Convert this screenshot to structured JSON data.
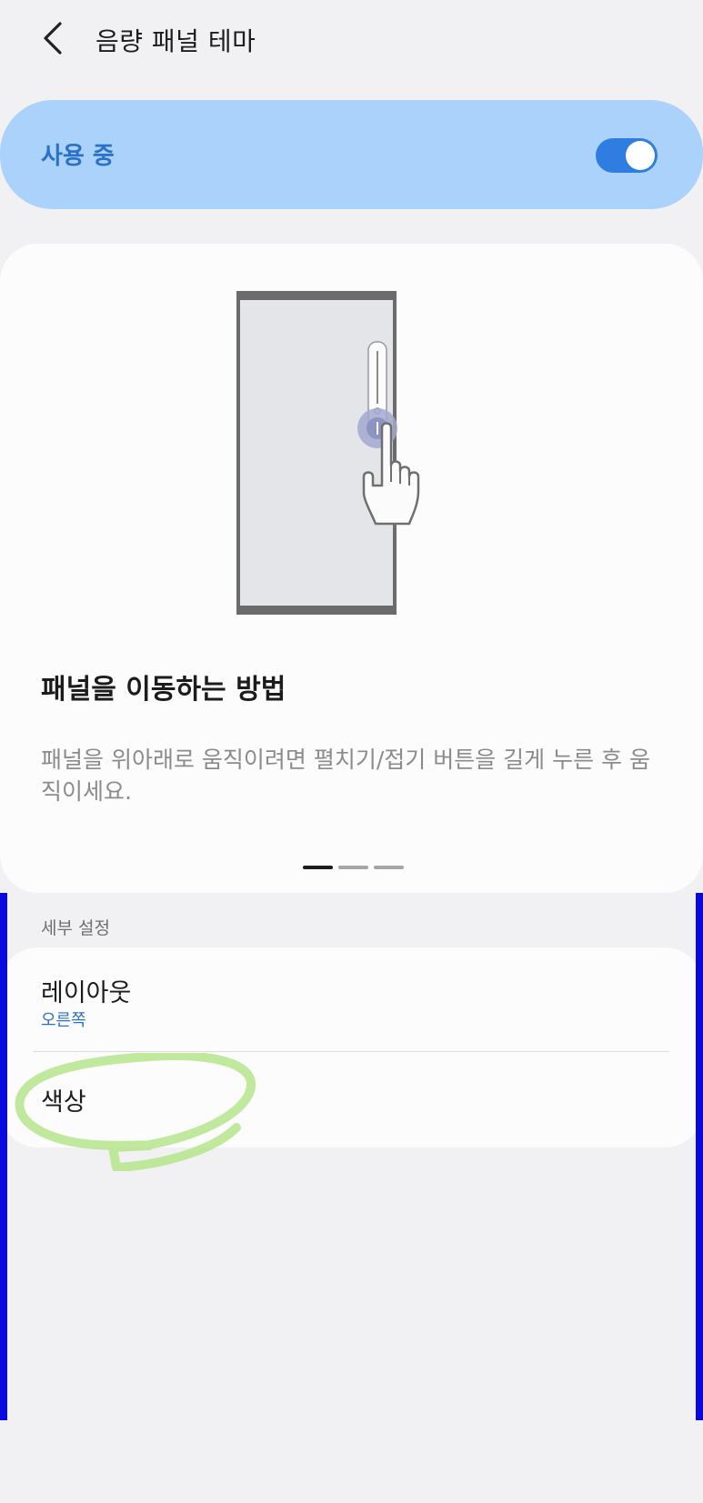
{
  "header": {
    "title": "음량 패널 테마",
    "back_icon": "chevron-left-icon"
  },
  "master_switch": {
    "label": "사용 중",
    "checked": true
  },
  "guide": {
    "title": "패널을 이동하는 방법",
    "description": "패널을 위아래로 움직이려면 펼치기/접기 버튼을 길게 누른 후 움직이세요.",
    "illustration_icon": "phone-volume-panel-drag-illustration",
    "pager": {
      "total": 3,
      "current": 1
    }
  },
  "details": {
    "section_header": "세부 설정",
    "layout": {
      "title": "레이아웃",
      "value": "오른쪽"
    },
    "color": {
      "title": "색상"
    }
  },
  "colors": {
    "accent": "#2a72c9",
    "toggle": "#2f7de1",
    "banner": "#aad2fb",
    "side_bars": "#0a0ae0",
    "highlight_circle": "#b5e58c"
  }
}
